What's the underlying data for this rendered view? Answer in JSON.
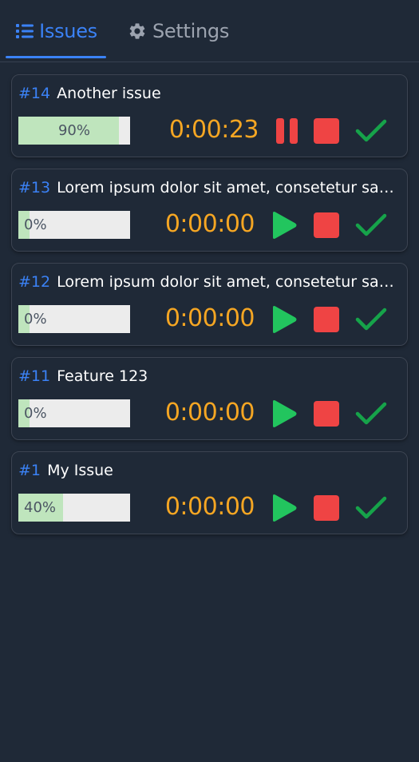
{
  "tabs": {
    "issues": {
      "label": "Issues",
      "icon": "list-icon",
      "active": true
    },
    "settings": {
      "label": "Settings",
      "icon": "gear-icon",
      "active": false
    }
  },
  "colors": {
    "background": "#1f2937",
    "accent": "#3b82f6",
    "timer": "#f5a623",
    "play": "#22c55e",
    "pause": "#ef4444",
    "stop": "#ef4444",
    "done": "#16a34a",
    "progress_fill": "#bfe5bd",
    "progress_track": "#ececec"
  },
  "issues": [
    {
      "number": "#14",
      "title": "Another issue",
      "progress_label": "90%",
      "progress": 0.9,
      "timer": "0:00:23",
      "running": true
    },
    {
      "number": "#13",
      "title": "Lorem ipsum dolor sit amet, consetetur sadipscing elitr",
      "progress_label": "0%",
      "progress": 0,
      "timer": "0:00:00",
      "running": false
    },
    {
      "number": "#12",
      "title": "Lorem ipsum dolor sit amet, consetetur sadipscing elitr",
      "progress_label": "0%",
      "progress": 0,
      "timer": "0:00:00",
      "running": false
    },
    {
      "number": "#11",
      "title": "Feature 123",
      "progress_label": "0%",
      "progress": 0,
      "timer": "0:00:00",
      "running": false
    },
    {
      "number": "#1",
      "title": "My Issue",
      "progress_label": "40%",
      "progress": 0.4,
      "timer": "0:00:00",
      "running": false
    }
  ]
}
